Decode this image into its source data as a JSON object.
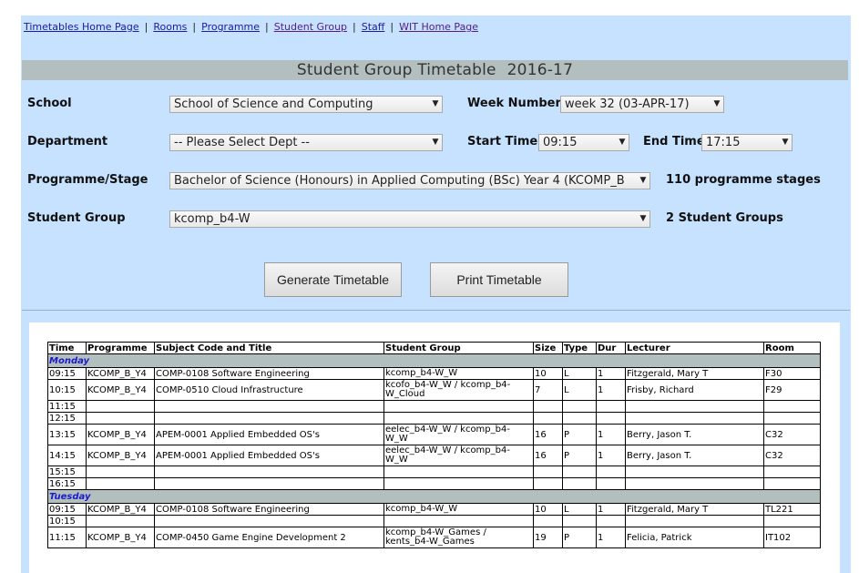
{
  "nav": {
    "links": [
      "Timetables Home Page",
      "Rooms",
      "Programme",
      "Student Group",
      "Staff",
      "WIT Home Page"
    ],
    "separator": "|"
  },
  "header": {
    "title": "Student Group Timetable",
    "year": "2016-17"
  },
  "form": {
    "school_label": "School",
    "school_value": "School of Science and Computing",
    "week_label": "Week Number",
    "week_value": "week 32 (03-APR-17)",
    "department_label": "Department",
    "department_value": "-- Please Select Dept --",
    "start_label": "Start Time",
    "start_value": "09:15",
    "end_label": "End Time",
    "end_value": "17:15",
    "programme_label": "Programme/Stage",
    "programme_value": "Bachelor of Science (Honours) in Applied Computing (BSc) Year 4 (KCOMP_B",
    "programme_count": "110 programme stages",
    "group_label": "Student Group",
    "group_value": "kcomp_b4-W",
    "group_count": "2 Student Groups",
    "generate_label": "Generate Timetable",
    "print_label": "Print Timetable"
  },
  "timetable": {
    "columns": [
      "Time",
      "Programme",
      "Subject Code and Title",
      "Student Group",
      "Size",
      "Type",
      "Dur",
      "Lecturer",
      "Room"
    ],
    "days": [
      {
        "name": "Monday",
        "rows": [
          [
            "09:15",
            "KCOMP_B_Y4",
            "COMP-0108 Software Engineering",
            "kcomp_b4-W_W",
            "10",
            "L",
            "1",
            "Fitzgerald, Mary T",
            "F30"
          ],
          [
            "10:15",
            "KCOMP_B_Y4",
            "COMP-0510 Cloud Infrastructure",
            "kcofo_b4-W_W / kcomp_b4-W_Cloud",
            "7",
            "L",
            "1",
            "Frisby, Richard",
            "F29"
          ],
          [
            "11:15",
            "",
            "",
            "",
            "",
            "",
            "",
            "",
            ""
          ],
          [
            "12:15",
            "",
            "",
            "",
            "",
            "",
            "",
            "",
            ""
          ],
          [
            "13:15",
            "KCOMP_B_Y4",
            "APEM-0001 Applied Embedded OS's",
            "eelec_b4-W_W / kcomp_b4-W_W",
            "16",
            "P",
            "1",
            "Berry, Jason T.",
            "C32"
          ],
          [
            "14:15",
            "KCOMP_B_Y4",
            "APEM-0001 Applied Embedded OS's",
            "eelec_b4-W_W / kcomp_b4-W_W",
            "16",
            "P",
            "1",
            "Berry, Jason T.",
            "C32"
          ],
          [
            "15:15",
            "",
            "",
            "",
            "",
            "",
            "",
            "",
            ""
          ],
          [
            "16:15",
            "",
            "",
            "",
            "",
            "",
            "",
            "",
            ""
          ]
        ]
      },
      {
        "name": "Tuesday",
        "rows": [
          [
            "09:15",
            "KCOMP_B_Y4",
            "COMP-0108 Software Engineering",
            "kcomp_b4-W_W",
            "10",
            "L",
            "1",
            "Fitzgerald, Mary T",
            "TL221"
          ],
          [
            "10:15",
            "",
            "",
            "",
            "",
            "",
            "",
            "",
            ""
          ],
          [
            "11:15",
            "KCOMP_B_Y4",
            "COMP-0450 Game Engine Development 2",
            "kcomp_b4-W_Games / kents_b4-W_Games",
            "19",
            "P",
            "1",
            "Felicia, Patrick",
            "IT102"
          ]
        ]
      }
    ]
  }
}
